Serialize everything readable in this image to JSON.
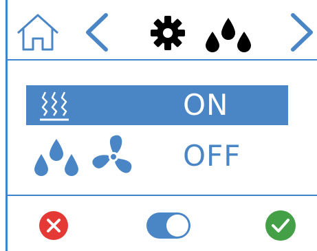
{
  "colors": {
    "accent": "#4a86c6",
    "border": "#3d86c9",
    "cancel": "#e53935",
    "confirm": "#43a047",
    "icon_dark": "#000000"
  },
  "header": {
    "icons": [
      "home-icon",
      "chevron-left-icon",
      "gear-icon",
      "water-drops-icon",
      "chevron-right-icon"
    ]
  },
  "rows": [
    {
      "icon": "heater-icon",
      "state": "ON",
      "selected": true
    },
    {
      "icons": [
        "water-drops-icon",
        "fan-icon"
      ],
      "state": "OFF",
      "selected": false
    }
  ],
  "footer": {
    "icons": [
      "cancel-icon",
      "toggle-icon",
      "confirm-icon"
    ],
    "toggle_on": true
  }
}
